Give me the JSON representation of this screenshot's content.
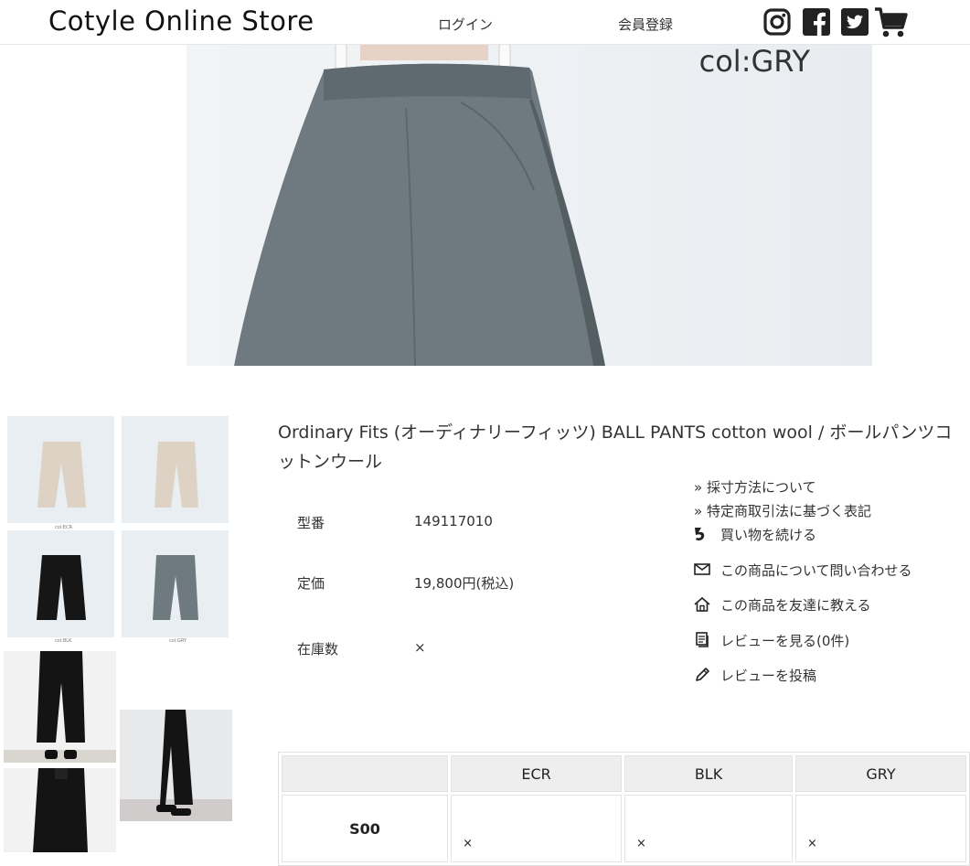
{
  "header": {
    "logo": "Cotyle Online Store",
    "login": "ログイン",
    "register": "会員登録",
    "icons": [
      "instagram-icon",
      "facebook-icon",
      "twitter-icon",
      "cart-icon"
    ]
  },
  "hero": {
    "label": "col:GRY"
  },
  "thumbnails": [
    {
      "caption": "col:ECR"
    },
    {
      "caption": ""
    },
    {
      "caption": "col:BLK"
    },
    {
      "caption": "col:GRY"
    }
  ],
  "product": {
    "title": "Ordinary Fits (オーディナリーフィッツ) BALL PANTS cotton wool / ボールパンツコットンウール",
    "specs": [
      {
        "label": "型番",
        "value": "149117010"
      },
      {
        "label": "定価",
        "value": "19,800円(税込)"
      },
      {
        "label": "在庫数",
        "value": "×"
      }
    ]
  },
  "links": {
    "measure": "» 採寸方法について",
    "law": "» 特定商取引法に基づく表記"
  },
  "actions": [
    {
      "icon": "return-arrow-icon",
      "label": "買い物を続ける"
    },
    {
      "icon": "mail-icon",
      "label": "この商品について問い合わせる"
    },
    {
      "icon": "home-icon",
      "label": "この商品を友達に教える"
    },
    {
      "icon": "document-icon",
      "label": "レビューを見る(0件)"
    },
    {
      "icon": "pencil-icon",
      "label": "レビューを投稿"
    }
  ],
  "stock_table": {
    "columns": [
      "ECR",
      "BLK",
      "GRY"
    ],
    "rows": [
      {
        "size": "S00",
        "values": [
          "×",
          "×",
          "×"
        ]
      }
    ]
  },
  "colors": {
    "gray_pants": "#6e7a80",
    "beige_pants": "#ddd2c3",
    "black_pants": "#161616",
    "photo_bg": "#eef1f4"
  }
}
